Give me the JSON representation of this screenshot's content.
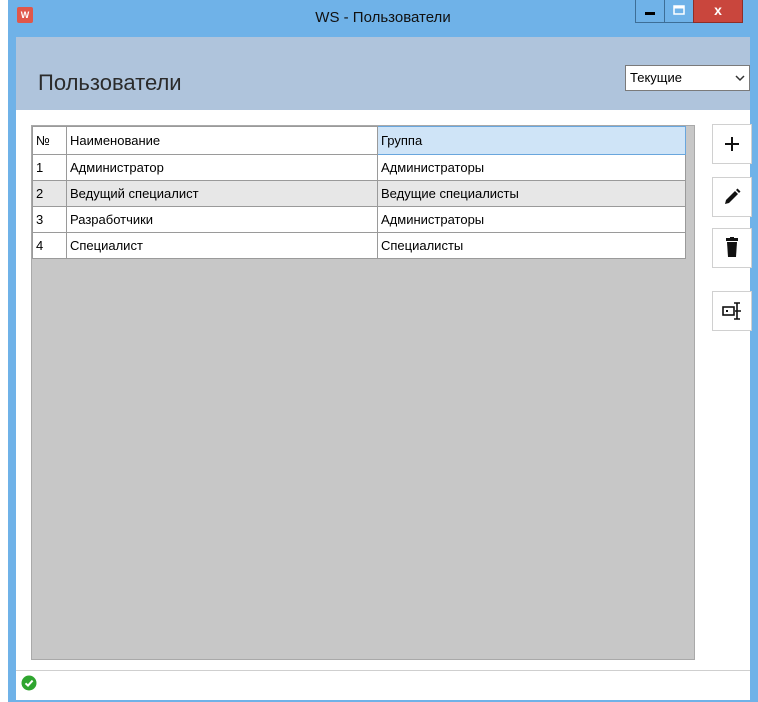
{
  "window": {
    "title": "WS - Пользователи",
    "app_icon_label": "W",
    "minimize_icon": "minimize-icon",
    "maximize_icon": "maximize-icon",
    "close_label": "x"
  },
  "header": {
    "title": "Пользователи",
    "filter_value": "Текущие"
  },
  "grid": {
    "columns": [
      "№",
      "Наименование",
      "Группа"
    ],
    "rows": [
      {
        "num": "1",
        "name": "Администратор",
        "group": "Администраторы"
      },
      {
        "num": "2",
        "name": "Ведущий специалист",
        "group": "Ведущие специалисты"
      },
      {
        "num": "3",
        "name": "Разработчики",
        "group": "Администраторы"
      },
      {
        "num": "4",
        "name": "Специалист",
        "group": "Специалисты"
      }
    ]
  },
  "toolbar": {
    "add_icon": "plus-icon",
    "edit_icon": "pencil-icon",
    "delete_icon": "trash-icon",
    "rename_icon": "text-cursor-icon"
  },
  "status": {
    "icon": "check-icon"
  },
  "colors": {
    "title_bar": "#6fb2e8",
    "header_band": "#afc4dc",
    "close_button": "#c9463d",
    "grid_bg": "#c7c7c7",
    "selected_header": "#cfe4f7",
    "status_ok": "#2fa52f"
  }
}
